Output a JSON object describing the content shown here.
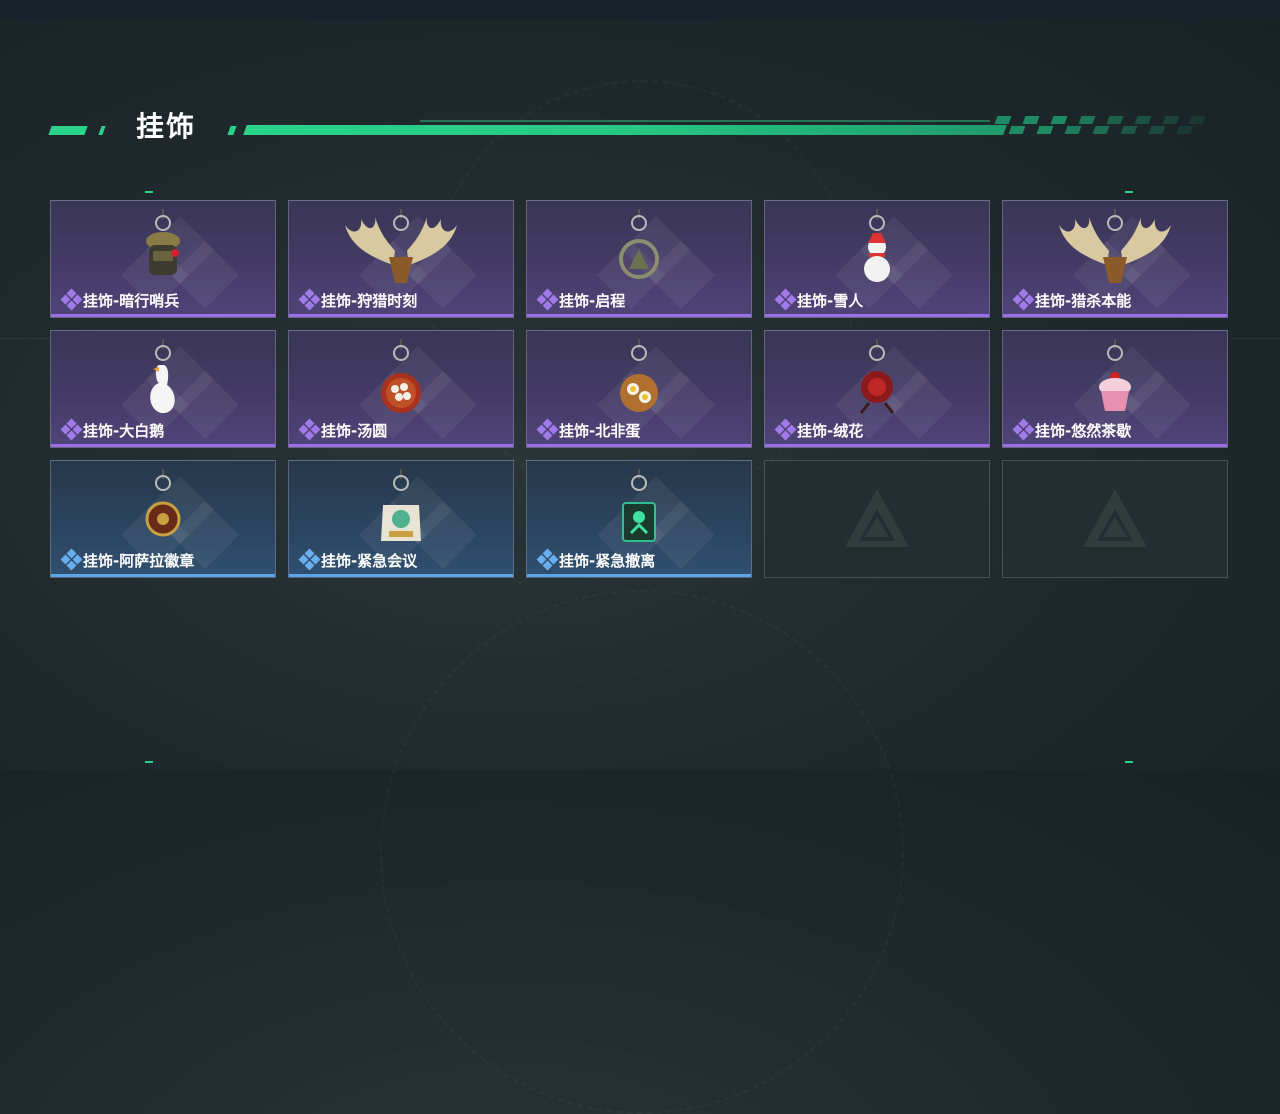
{
  "header": {
    "title": "挂饰"
  },
  "items": [
    {
      "label": "挂饰-暗行哨兵",
      "rarity": "purple",
      "icon": "soldier-charm-icon"
    },
    {
      "label": "挂饰-狩猎时刻",
      "rarity": "purple",
      "icon": "antlers-charm-icon"
    },
    {
      "label": "挂饰-启程",
      "rarity": "purple",
      "icon": "medallion-charm-icon"
    },
    {
      "label": "挂饰-雪人",
      "rarity": "purple",
      "icon": "snowman-charm-icon"
    },
    {
      "label": "挂饰-猎杀本能",
      "rarity": "purple",
      "icon": "antlers-charm-icon"
    },
    {
      "label": "挂饰-大白鹅",
      "rarity": "purple",
      "icon": "goose-charm-icon"
    },
    {
      "label": "挂饰-汤圆",
      "rarity": "purple",
      "icon": "bowl-charm-icon"
    },
    {
      "label": "挂饰-北非蛋",
      "rarity": "purple",
      "icon": "shakshuka-charm-icon"
    },
    {
      "label": "挂饰-绒花",
      "rarity": "purple",
      "icon": "flower-charm-icon"
    },
    {
      "label": "挂饰-悠然茶歇",
      "rarity": "purple",
      "icon": "cupcake-charm-icon"
    },
    {
      "label": "挂饰-阿萨拉徽章",
      "rarity": "blue",
      "icon": "badge-charm-icon"
    },
    {
      "label": "挂饰-紧急会议",
      "rarity": "blue",
      "icon": "meeting-charm-icon"
    },
    {
      "label": "挂饰-紧急撤离",
      "rarity": "blue",
      "icon": "evac-charm-icon"
    },
    {
      "label": "",
      "rarity": "empty",
      "icon": "game-logo-icon"
    },
    {
      "label": "",
      "rarity": "empty",
      "icon": "game-logo-icon"
    }
  ],
  "colors": {
    "accent": "#2ad28a",
    "purple": "#9b6fe6",
    "blue": "#5aa6e8"
  }
}
